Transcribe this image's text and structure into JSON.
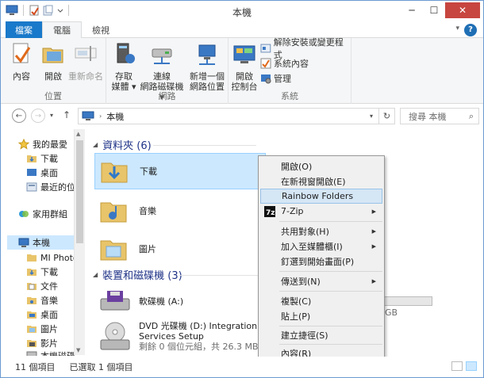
{
  "window": {
    "title": "本機"
  },
  "ribbon_tabs": [
    "檔案",
    "電腦",
    "檢視"
  ],
  "ribbon": {
    "location_group": {
      "label": "位置",
      "buttons": [
        "內容",
        "開啟",
        "重新命名"
      ]
    },
    "network_group": {
      "label": "網路",
      "buttons": [
        {
          "line1": "存取",
          "line2": "媒體 ▾"
        },
        {
          "line1": "連線",
          "line2": "網路磁碟機 ▾"
        },
        {
          "line1": "新增一個",
          "line2": "網路位置"
        }
      ]
    },
    "system_group": {
      "label": "系統",
      "open_cp": {
        "line1": "開啟",
        "line2": "控制台"
      },
      "small_buttons": [
        "解除安裝或變更程式",
        "系統內容",
        "管理"
      ]
    }
  },
  "addressbar": {
    "path_label": "本機",
    "search_placeholder": "搜尋 本機"
  },
  "navpane": {
    "items": [
      {
        "label": "我的最愛",
        "icon": "star-icon"
      },
      {
        "label": "下載",
        "icon": "downloads-folder-icon"
      },
      {
        "label": "桌面",
        "icon": "desktop-icon"
      },
      {
        "label": "最近的位",
        "icon": "recent-places-icon"
      },
      {
        "label": "家用群組",
        "icon": "homegroup-icon"
      },
      {
        "label": "本機",
        "icon": "computer-icon"
      },
      {
        "label": "MI Photo",
        "icon": "folder-icon"
      },
      {
        "label": "下載",
        "icon": "downloads-folder-icon"
      },
      {
        "label": "文件",
        "icon": "documents-folder-icon"
      },
      {
        "label": "音樂",
        "icon": "music-folder-icon"
      },
      {
        "label": "桌面",
        "icon": "desktop-icon"
      },
      {
        "label": "圖片",
        "icon": "pictures-folder-icon"
      },
      {
        "label": "影片",
        "icon": "videos-folder-icon"
      },
      {
        "label": "本機磁碟",
        "icon": "drive-icon"
      }
    ]
  },
  "content": {
    "folders_header": "資料夾 (6)",
    "folders": [
      "下載",
      "音樂",
      "圖片"
    ],
    "drives_header": "裝置和磁碟機 (3)",
    "drives": [
      {
        "name": "軟碟機 (A:)"
      },
      {
        "name_line1": "DVD 光碟機 (D:) Integration",
        "name_line2": "Services Setup",
        "detail": "剩餘 0 個位元組，共 26.3 MB"
      }
    ],
    "partial_drive_size_fragment": "GB"
  },
  "context_menu": {
    "items": [
      {
        "label": "開啟(O)"
      },
      {
        "label": "在新視窗開啟(E)"
      },
      {
        "label": "Rainbow Folders",
        "highlighted": true
      },
      {
        "label": "7-Zip",
        "submenu": true
      },
      {
        "label": "共用對象(H)",
        "submenu": true
      },
      {
        "label": "加入至媒體櫃(I)",
        "submenu": true
      },
      {
        "label": "釘選到開始畫面(P)"
      },
      {
        "label": "傳送到(N)",
        "submenu": true
      },
      {
        "label": "複製(C)"
      },
      {
        "label": "貼上(P)"
      },
      {
        "label": "建立捷徑(S)"
      },
      {
        "label": "內容(R)"
      }
    ]
  },
  "statusbar": {
    "count": "11 個項目",
    "selected": "已選取 1 個項目"
  },
  "colors": {
    "accent": "#1979ca",
    "selection": "#cce8ff",
    "section_header": "#1e3287",
    "close_button": "#c7463f"
  }
}
